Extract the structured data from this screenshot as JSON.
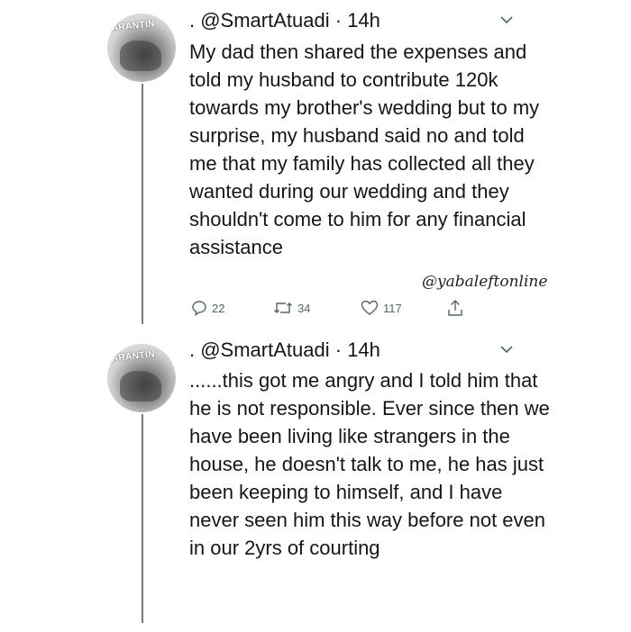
{
  "tweets": [
    {
      "avatar_label": "UARANTIN",
      "handle": ". @SmartAtuadi",
      "time": "14h",
      "text": "My dad then shared the expenses and told my husband to contribute 120k towards my brother's wedding but to my surprise, my husband said no and told me that my family has collected all they wanted during our wedding and they shouldn't come to him for any financial assistance",
      "watermark": "@yabaleftonline",
      "actions": {
        "replies": "22",
        "retweets": "34",
        "likes": "117"
      }
    },
    {
      "avatar_label": "UARANTIN",
      "handle": ". @SmartAtuadi",
      "time": "14h",
      "text": "......this got me angry and I told him that he is not responsible. Ever since then we have been living like strangers in the house, he doesn't talk to me, he has just been keeping to himself, and I have never seen him this way before not even in our 2yrs of courting"
    }
  ],
  "icons": {
    "reply": "speech-bubble-icon",
    "retweet": "retweet-icon",
    "like": "heart-icon",
    "share": "share-icon",
    "menu": "chevron-down-icon"
  },
  "colors": {
    "text": "#14171a",
    "icon": "#536471",
    "thread_line": "#7a7a7a"
  }
}
